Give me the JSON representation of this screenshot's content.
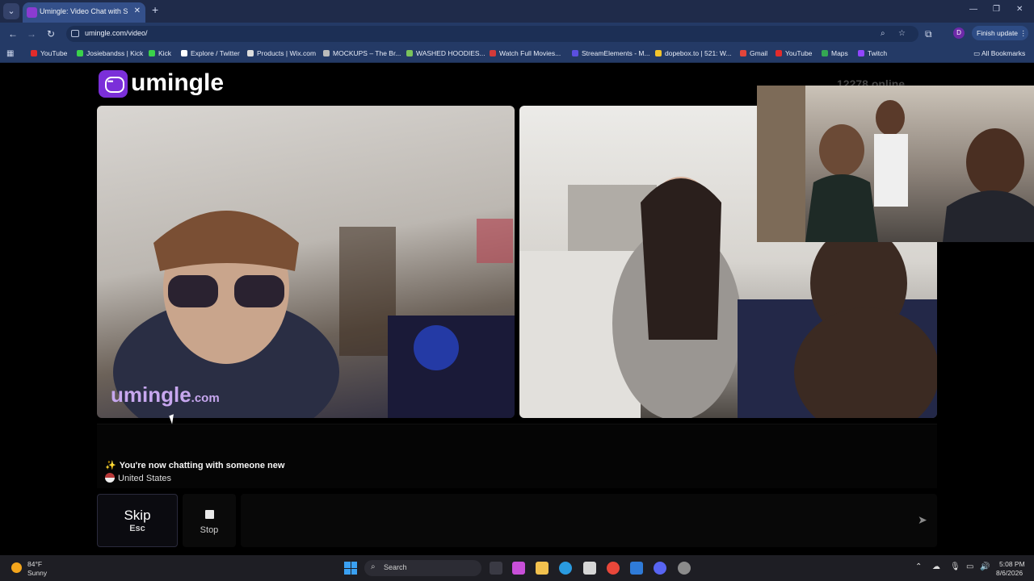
{
  "browser": {
    "tab_title": "Umingle: Video Chat with S",
    "tab_close": "✕",
    "new_tab": "+",
    "url": "umingle.com/video/",
    "finish_update": "Finish update",
    "profile_initial": "D",
    "bookmarks": [
      {
        "label": "YouTube",
        "color": "#e22b2b"
      },
      {
        "label": "Josiebandss | Kick",
        "color": "#3ad24a"
      },
      {
        "label": "Kick",
        "color": "#3ad24a"
      },
      {
        "label": "Explore / Twitter",
        "color": "#ffffff"
      },
      {
        "label": "Products | Wix.com",
        "color": "#dddddd"
      },
      {
        "label": "MOCKUPS – The Br...",
        "color": "#bbbbbb"
      },
      {
        "label": "WASHED HOODIES...",
        "color": "#7ac35b"
      },
      {
        "label": "Watch Full Movies...",
        "color": "#d23a3a"
      },
      {
        "label": "StreamElements - M...",
        "color": "#5b4fe0"
      },
      {
        "label": "dopebox.to | 521: W...",
        "color": "#f3c52b"
      },
      {
        "label": "Gmail",
        "color": "#e2453b"
      },
      {
        "label": "YouTube",
        "color": "#e22b2b"
      },
      {
        "label": "Maps",
        "color": "#34a853"
      },
      {
        "label": "Twitch",
        "color": "#9146ff"
      }
    ],
    "all_bookmarks": "All Bookmarks"
  },
  "site": {
    "logo_text": "umingle",
    "online_count": "12278",
    "online_suffix": "online",
    "watermark": "umingle",
    "watermark_suffix": ".com"
  },
  "chat": {
    "status_message": "You're now chatting with someone new",
    "country": "United States"
  },
  "controls": {
    "skip_label": "Skip",
    "skip_key": "Esc",
    "stop_label": "Stop",
    "message_placeholder": ""
  },
  "taskbar": {
    "temperature": "84°F",
    "condition": "Sunny",
    "search_placeholder": "Search",
    "time": "5:08 PM",
    "date": "8/6/2026"
  },
  "colors": {
    "brand_purple": "#7b2fd9",
    "chrome_bg": "#243a66",
    "page_bg": "#000000"
  }
}
